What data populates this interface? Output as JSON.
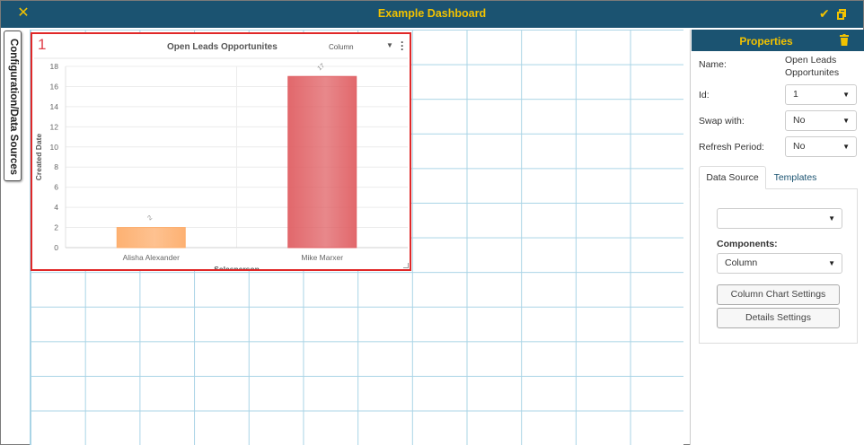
{
  "window": {
    "title": "Example Dashboard",
    "close_icon": "close-icon",
    "save_icon": "check-icon",
    "copy_icon": "copy-icon",
    "accent_color": "#f2c200",
    "bar_color": "#1b5371"
  },
  "sidebar": {
    "tab_label": "Configuration/Data Sources"
  },
  "widget": {
    "number": "1",
    "title": "Open Leads Opportunites",
    "type_label": "Column",
    "menu_icon": "kebab-menu-icon"
  },
  "chart_data": {
    "type": "bar",
    "title": "",
    "categories": [
      "Alisha Alexander",
      "Mike Marxer"
    ],
    "values": [
      2,
      17
    ],
    "data_labels": [
      "2",
      "17"
    ],
    "colors": [
      "#fdad6b",
      "#e06064"
    ],
    "xlabel": "Salesperson",
    "ylabel": "Created Date",
    "ylim": [
      0,
      18
    ],
    "yticks": [
      0,
      2,
      4,
      6,
      8,
      10,
      12,
      14,
      16,
      18
    ],
    "grid": true
  },
  "properties": {
    "title": "Properties",
    "delete_icon": "trash-icon",
    "name_label": "Name:",
    "name_value": "Open Leads Opportunites",
    "id_label": "Id:",
    "id_value": "1",
    "swap_label": "Swap with:",
    "swap_value": "No",
    "refresh_label": "Refresh Period:",
    "refresh_value": "No",
    "tabs": [
      {
        "label": "Data Source",
        "active": true
      },
      {
        "label": "Templates",
        "active": false
      }
    ],
    "datasource_value": "",
    "components_label": "Components:",
    "components_value": "Column",
    "column_chart_settings_label": "Column Chart Settings",
    "details_settings_label": "Details Settings"
  }
}
